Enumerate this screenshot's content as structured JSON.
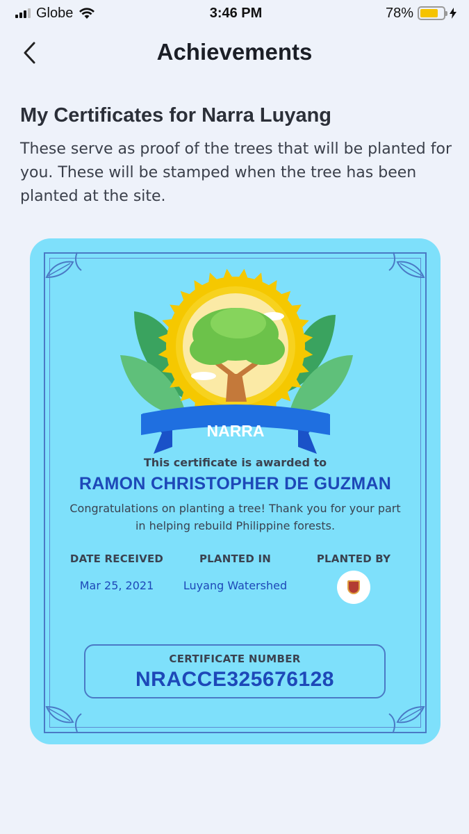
{
  "status_bar": {
    "carrier": "Globe",
    "time": "3:46 PM",
    "battery_percent": "78%",
    "battery_level": 0.78
  },
  "nav": {
    "title": "Achievements",
    "back_icon": "chevron-left-icon"
  },
  "section": {
    "heading": "My Certificates for Narra Luyang",
    "description": "These serve as proof of the trees that will be planted for you. These will be stamped when the tree has been planted at the site."
  },
  "certificate": {
    "tree_name": "NARRA",
    "awarded_to_label": "This certificate is awarded to",
    "recipient": "RAMON CHRISTOPHER DE GUZMAN",
    "message": "Congratulations on planting a tree! Thank you for your part in helping rebuild Philippine forests.",
    "details": {
      "date_received_label": "DATE RECEIVED",
      "date_received": "Mar 25, 2021",
      "planted_in_label": "PLANTED IN",
      "planted_in": "Luyang Watershed",
      "planted_by_label": "PLANTED BY"
    },
    "number_label": "CERTIFICATE NUMBER",
    "number": "NRACCE325676128",
    "colors": {
      "card": "#7ee0fb",
      "accent": "#1d48b8",
      "ribbon": "#1f6fe0",
      "sun": "#f7d21e"
    }
  }
}
